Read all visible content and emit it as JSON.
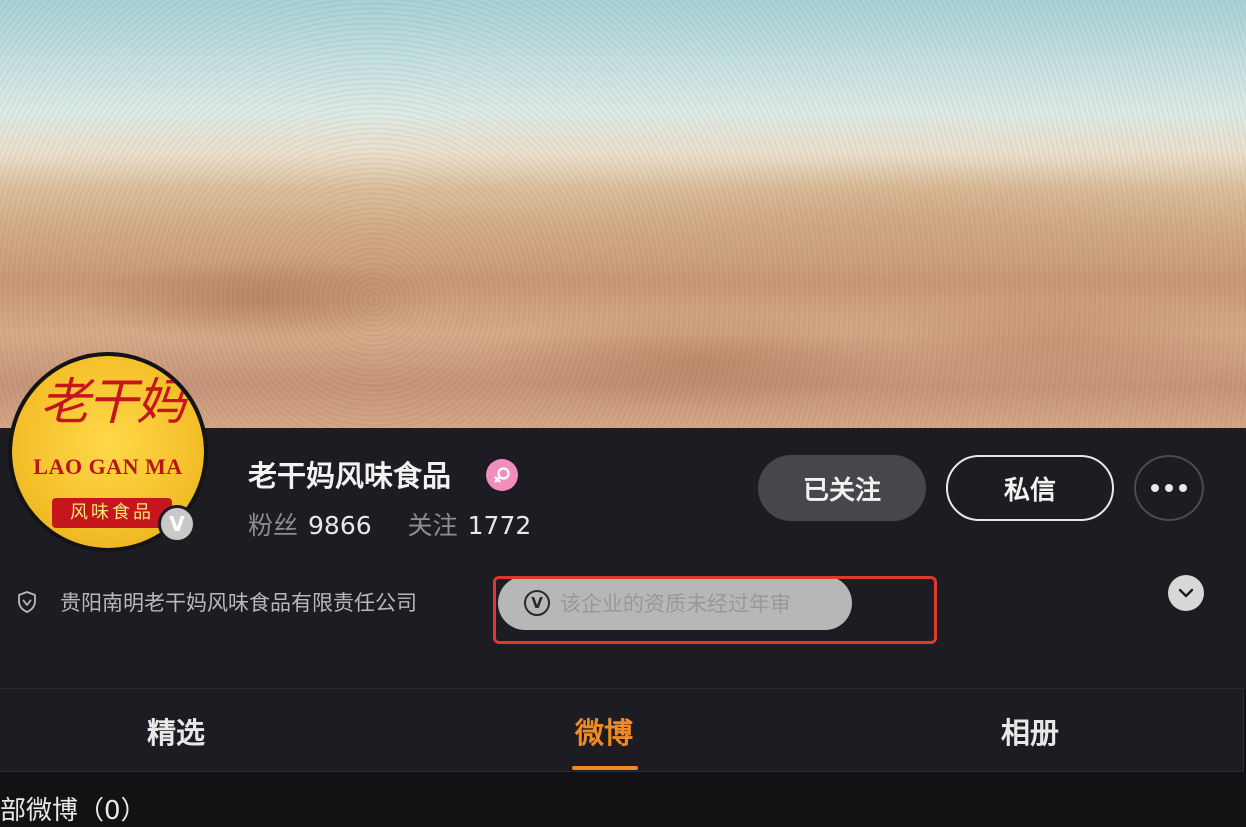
{
  "profile": {
    "name": "老干妈风味食品",
    "stats": {
      "followers_label": "粉丝",
      "followers_value": "9866",
      "following_label": "关注",
      "following_value": "1772"
    },
    "company": "贵阳南明老干妈风味食品有限责任公司",
    "audit_notice": "该企业的资质未经过年审",
    "avatar_logo": {
      "script_text": "老干妈",
      "latin_text": "LAO GAN MA",
      "sub_text": "风味食品"
    },
    "verify_badge": "V",
    "audit_badge": "V",
    "gender_icon": "female-icon"
  },
  "actions": {
    "followed_label": "已关注",
    "message_label": "私信",
    "more_icon": "ellipsis-icon"
  },
  "tabs": [
    {
      "label": "精选",
      "active": false
    },
    {
      "label": "微博",
      "active": true
    },
    {
      "label": "相册",
      "active": false
    }
  ],
  "feed": {
    "title": "部微博（0）"
  },
  "colors": {
    "accent": "#f08a24",
    "highlight_border": "#e0392b",
    "profile_bg": "#1c1c22",
    "gender_badge": "#f08fbd"
  }
}
